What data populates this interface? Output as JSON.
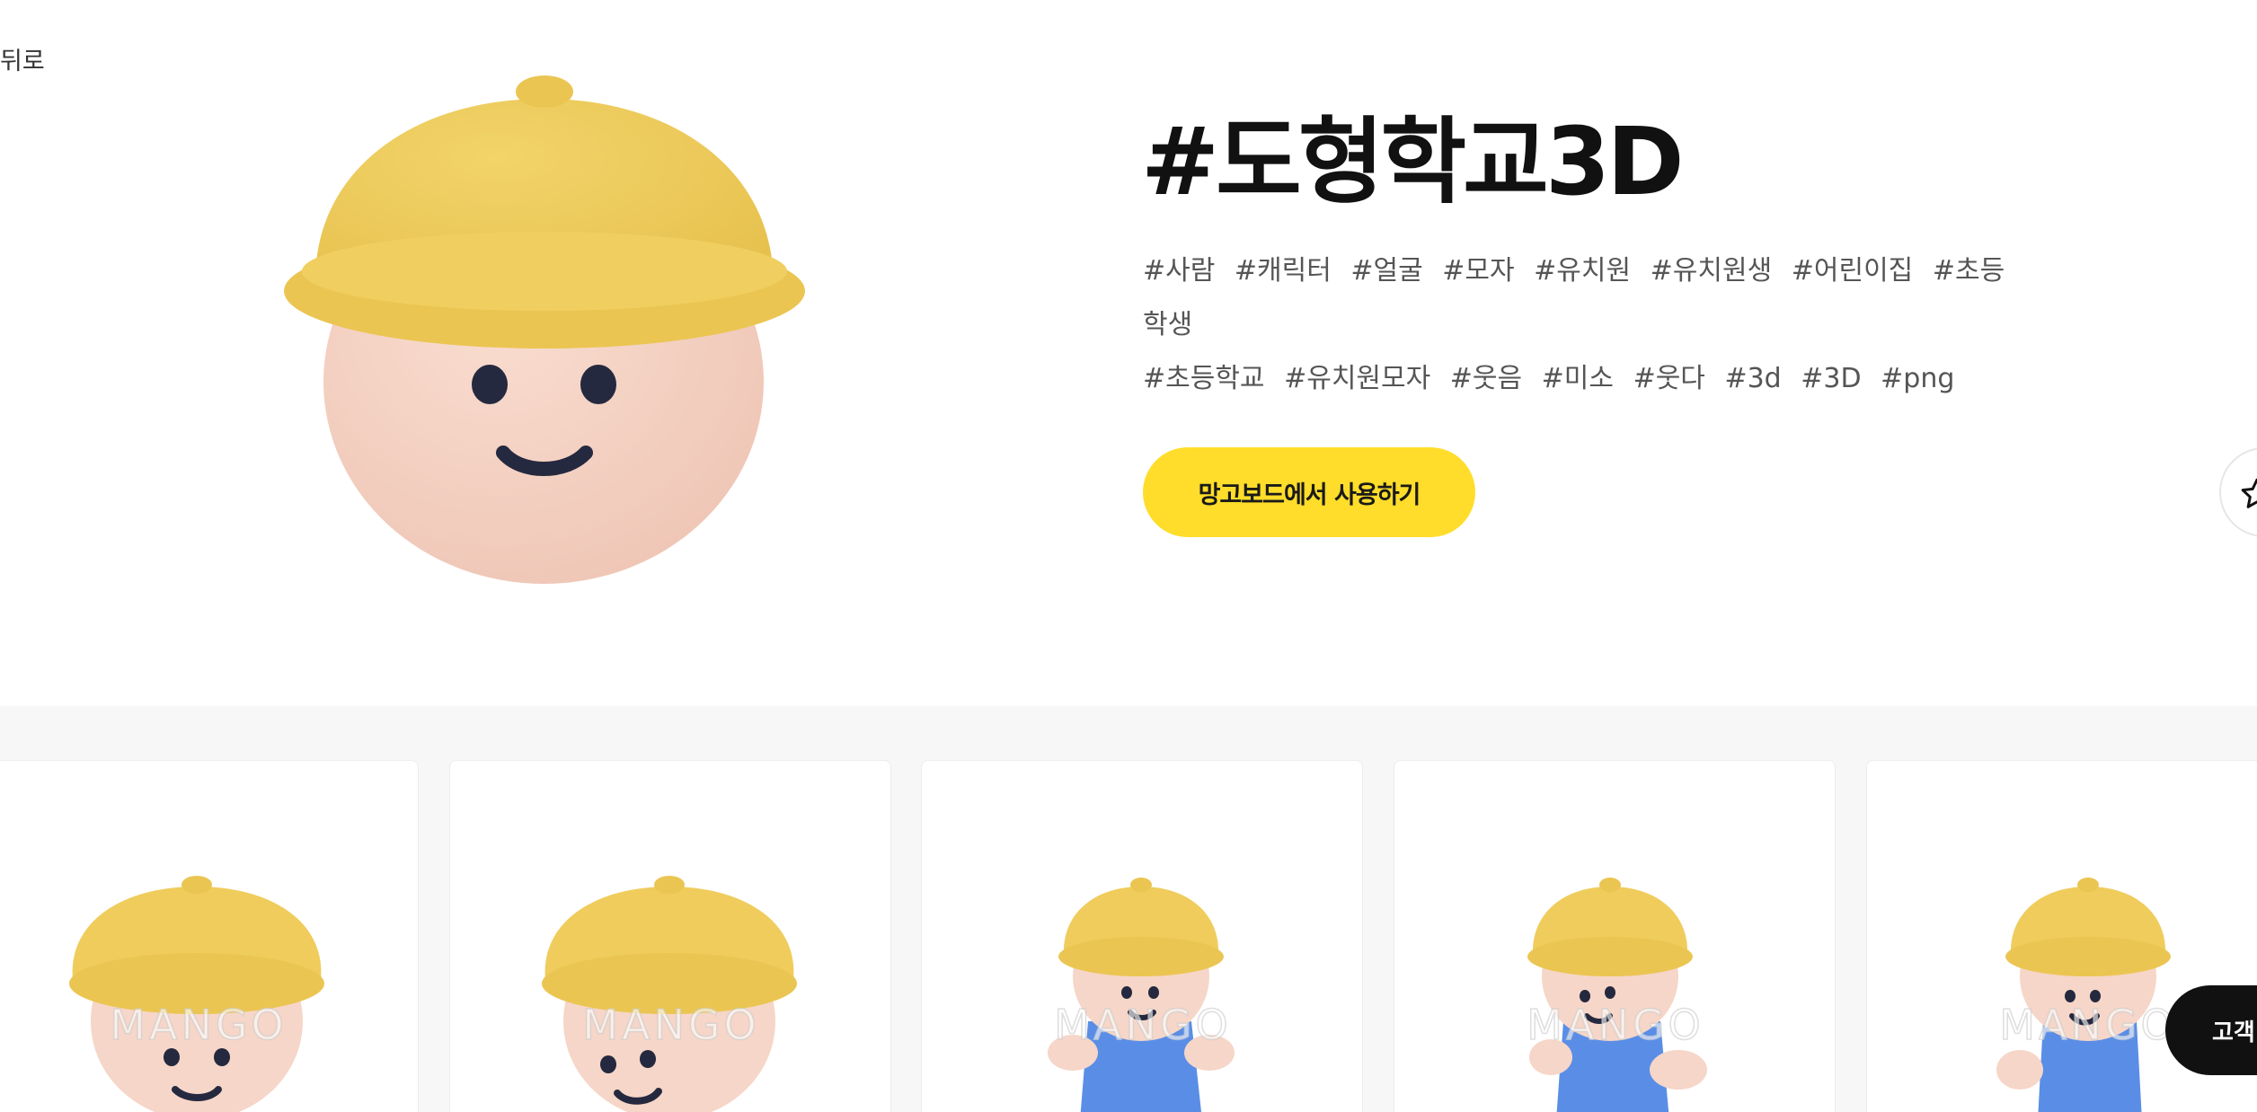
{
  "nav": {
    "back_label": "뒤로"
  },
  "asset": {
    "title": "#도형학교3D",
    "tags": [
      "#사람",
      "#캐릭터",
      "#얼굴",
      "#모자",
      "#유치원",
      "#유치원생",
      "#어린이집",
      "#초등학생",
      "#초등학교",
      "#유치원모자",
      "#웃음",
      "#미소",
      "#웃다",
      "#3d",
      "#3D",
      "#png"
    ],
    "use_button_label": "망고보드에서 사용하기"
  },
  "gallery": {
    "watermark": "MANGO",
    "items": [
      {
        "kind": "head"
      },
      {
        "kind": "head"
      },
      {
        "kind": "body"
      },
      {
        "kind": "body"
      },
      {
        "kind": "body"
      }
    ]
  },
  "floating": {
    "support_label": "고객"
  },
  "icons": {
    "favorite": "star-icon"
  },
  "colors": {
    "accent_yellow": "#FFDD2A",
    "hat_yellow": "#EFCC5C",
    "skin": "#F6D6C8",
    "feature_navy": "#25293F",
    "body_blue": "#5A8EE6",
    "leg_navy": "#2A47A6"
  }
}
